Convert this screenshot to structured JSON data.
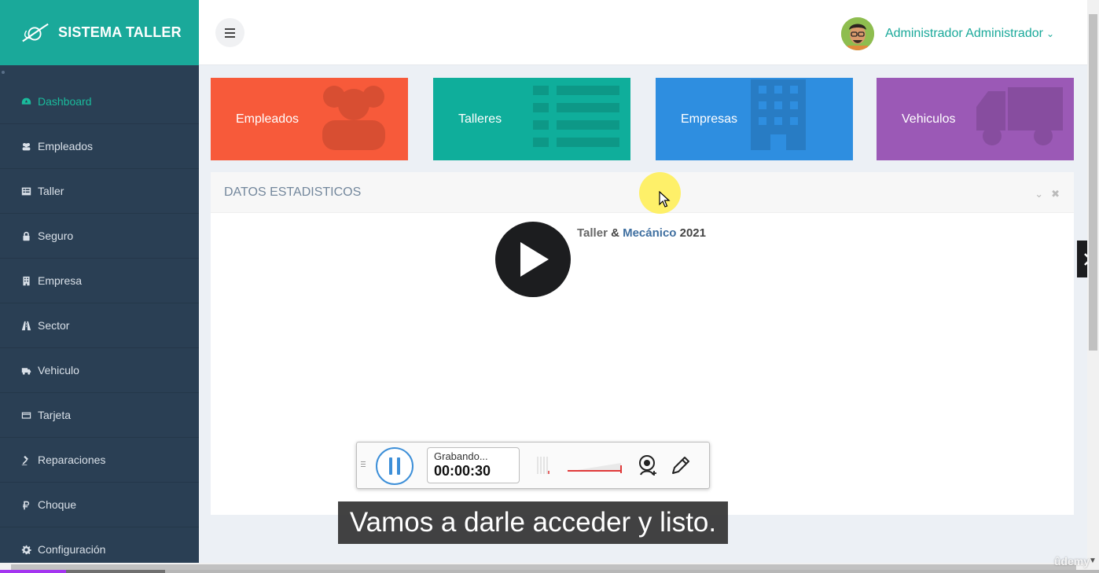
{
  "brand": {
    "title": "SISTEMA TALLER"
  },
  "sidebar": {
    "items": [
      {
        "label": "Dashboard",
        "icon": "dashboard-icon",
        "active": true
      },
      {
        "label": "Empleados",
        "icon": "users-icon"
      },
      {
        "label": "Taller",
        "icon": "list-icon"
      },
      {
        "label": "Seguro",
        "icon": "lock-icon"
      },
      {
        "label": "Empresa",
        "icon": "building-icon"
      },
      {
        "label": "Sector",
        "icon": "road-icon"
      },
      {
        "label": "Vehiculo",
        "icon": "truck-icon"
      },
      {
        "label": "Tarjeta",
        "icon": "credit-card-icon"
      },
      {
        "label": "Reparaciones",
        "icon": "gavel-icon"
      },
      {
        "label": "Choque",
        "icon": "ruble-icon"
      },
      {
        "label": "Configuración",
        "icon": "cog-icon"
      }
    ]
  },
  "topbar": {
    "user_name": "Administrador Administrador"
  },
  "cards": [
    {
      "label": "Empleados",
      "color": "#f75a3a",
      "icon": "users-icon"
    },
    {
      "label": "Talleres",
      "color": "#0fae9b",
      "icon": "list-icon"
    },
    {
      "label": "Empresas",
      "color": "#2e8ee0",
      "icon": "building-icon"
    },
    {
      "label": "Vehiculos",
      "color": "#9b59b6",
      "icon": "truck-icon"
    }
  ],
  "panel": {
    "title": "DATOS ESTADISTICOS",
    "chart_title_part1": "Taller",
    "chart_title_amp": "&",
    "chart_title_part2": "Mecánico",
    "chart_title_year": "2021"
  },
  "recorder": {
    "status": "Grabando...",
    "time": "00:00:30"
  },
  "subtitle": "Vamos a darle acceder y listo.",
  "video": {
    "progress": 0.06,
    "buffered": 0.15
  },
  "watermark": "ûdemy",
  "colors": {
    "accent": "#1aa99a",
    "sidebar": "#2a3f54",
    "udemy_purple": "#a435f0"
  }
}
